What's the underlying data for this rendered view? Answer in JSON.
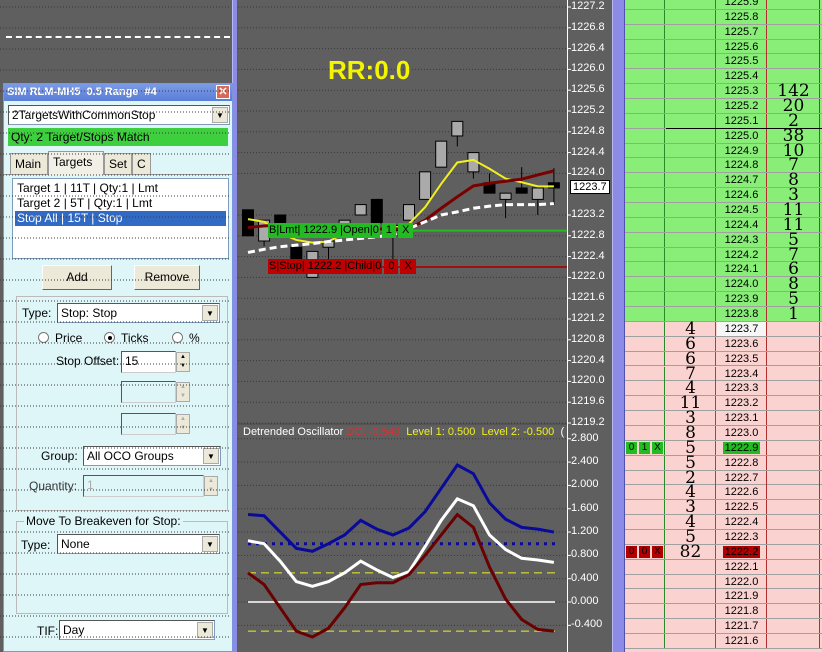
{
  "colors": {
    "chart_bg": "#5f5f5f",
    "ask_bg": "#88ee77",
    "bid_bg": "#fad2d0",
    "buy": "#22bb22",
    "sell": "#c00000",
    "ma_fast": "#f0f020",
    "ma_slow": "#7a0000",
    "ma_dash": "#ffffff"
  },
  "panel": {
    "title": "SIM RLM-MH5  0.5 Range  #4",
    "close_icon": "close-icon",
    "strategy": "2TargetsWithCommonStop",
    "status": "Qty: 2 Target/Stops Match",
    "tabs": [
      "Main",
      "Targets",
      "Set",
      "C"
    ],
    "active_tab": "Targets",
    "list_items": [
      "Target 1 | 11T | Qty:1 | Lmt",
      "Target 2 | 5T | Qty:1 | Lmt",
      "Stop All | 15T | Stop"
    ],
    "selected_item": 2,
    "add_label": "Add",
    "remove_label": "Remove",
    "type_label": "Type:",
    "type_value": "Stop: Stop",
    "radio_price": "Price",
    "radio_ticks": "Ticks",
    "radio_pct": "%",
    "radio_selected": "Ticks",
    "stop_offset_label": "Stop Offset:",
    "stop_offset_value": "15",
    "group_label": "Group:",
    "group_value": "All OCO Groups",
    "quantity_label": "Quantity:",
    "quantity_value": "1",
    "breakeven_title": "Move To Breakeven for Stop:",
    "breakeven_type_label": "Type:",
    "breakeven_type_value": "None",
    "tif_label": "TIF:",
    "tif_value": "Day"
  },
  "chart": {
    "rr_label": "RR:0.0",
    "current_price": "1223.7",
    "price_ticks": [
      "1227.2",
      "1226.8",
      "1226.4",
      "1226.0",
      "1225.6",
      "1225.2",
      "1224.8",
      "1224.4",
      "1224.0",
      "1223.2",
      "1222.8",
      "1222.4",
      "1222.0",
      "1221.6",
      "1221.2",
      "1220.8",
      "1220.4",
      "1220.0",
      "1219.6",
      "1219.2"
    ],
    "buy_order": {
      "label": "B|Lmt| 1222.9 |Open|0",
      "qty": "1",
      "close": "X",
      "price": 1222.9
    },
    "stop_order": {
      "label": "S|Stop| 1222.2 |Child|0",
      "qty": "0",
      "close": "X",
      "price": 1222.2
    }
  },
  "chart_data": [
    {
      "type": "candlestick",
      "title": "",
      "ylim": [
        1219.2,
        1227.2
      ],
      "candles": [
        [
          1223.3,
          1223.3,
          1222.8,
          1222.8
        ],
        [
          1222.7,
          1223.1,
          1222.6,
          1223.1
        ],
        [
          1223.2,
          1223.2,
          1222.87,
          1222.87
        ],
        [
          1222.58,
          1222.58,
          1222.33,
          1222.33
        ],
        [
          1222.0,
          1222.5,
          1222.0,
          1222.5
        ],
        [
          1222.58,
          1222.7,
          1222.28,
          1222.7
        ],
        [
          1222.95,
          1223.1,
          1222.95,
          1223.1
        ],
        [
          1223.2,
          1223.4,
          1223.2,
          1223.4
        ],
        [
          1223.5,
          1223.5,
          1223.05,
          1223.05
        ],
        [
          1222.9,
          1223.0,
          1222.25,
          1223.0
        ],
        [
          1223.1,
          1223.4,
          1223.1,
          1223.4
        ],
        [
          1223.5,
          1224.03,
          1223.5,
          1224.03
        ],
        [
          1224.12,
          1224.62,
          1224.12,
          1224.62
        ],
        [
          1224.72,
          1225.0,
          1224.52,
          1225.0
        ],
        [
          1224.03,
          1224.4,
          1223.9,
          1224.4
        ],
        [
          1223.82,
          1224.0,
          1223.62,
          1223.62
        ],
        [
          1223.5,
          1223.62,
          1223.14,
          1223.62
        ],
        [
          1223.72,
          1224.12,
          1223.62,
          1223.62
        ],
        [
          1223.5,
          1223.72,
          1223.2,
          1223.72
        ],
        [
          1223.82,
          1224.1,
          1223.4,
          1223.72
        ]
      ],
      "candle_format": [
        "open",
        "high",
        "low",
        "close"
      ],
      "series": [
        {
          "name": "fast-ma",
          "values": [
            1223.12,
            1223.07,
            1222.85,
            1222.72,
            1222.67,
            1222.69,
            1222.85,
            1222.94,
            1222.94,
            1222.94,
            1223.03,
            1223.35,
            1223.8,
            1224.21,
            1224.26,
            1224.09,
            1223.9,
            1223.83,
            1223.75,
            1223.75
          ]
        },
        {
          "name": "slow-ma",
          "values": [
            1222.96,
            1222.99,
            1223.0,
            1222.98,
            1222.96,
            1222.95,
            1222.94,
            1222.94,
            1222.93,
            1222.93,
            1222.94,
            1223.1,
            1223.33,
            1223.55,
            1223.76,
            1223.81,
            1223.85,
            1223.89,
            1223.97,
            1224.05
          ]
        },
        {
          "name": "dashed-ma",
          "values": [
            1222.48,
            1222.54,
            1222.59,
            1222.62,
            1222.65,
            1222.69,
            1222.72,
            1222.75,
            1222.78,
            1222.82,
            1222.94,
            1223.07,
            1223.2,
            1223.26,
            1223.33,
            1223.37,
            1223.4,
            1223.4,
            1223.4,
            1223.42
          ]
        }
      ]
    },
    {
      "type": "line",
      "title": "Detrended Oscillator",
      "legend": [
        "DO: -0.540",
        "Level 1: 0.500",
        "Level 2: -0.500",
        "("
      ],
      "ylim": [
        -0.6,
        3.0
      ],
      "yticks": [
        "2.800",
        "2.400",
        "2.000",
        "1.600",
        "1.200",
        "0.800",
        "0.400",
        "0.000",
        "-0.400"
      ],
      "series": [
        {
          "name": "upper-band",
          "values": [
            1.5,
            1.48,
            1.2,
            0.92,
            0.87,
            1.0,
            1.15,
            1.4,
            1.25,
            1.15,
            1.27,
            1.55,
            1.95,
            2.35,
            2.2,
            1.7,
            1.42,
            1.28,
            1.25,
            1.2
          ]
        },
        {
          "name": "mid-band",
          "values": [
            1.05,
            1.0,
            0.7,
            0.35,
            0.27,
            0.35,
            0.5,
            0.7,
            0.55,
            0.42,
            0.52,
            0.95,
            1.4,
            1.77,
            1.65,
            1.15,
            0.9,
            0.75,
            0.72,
            0.68
          ]
        },
        {
          "name": "do",
          "values": [
            0.5,
            0.3,
            -0.1,
            -0.5,
            -0.6,
            -0.45,
            -0.1,
            0.3,
            0.33,
            0.33,
            0.47,
            0.8,
            1.15,
            1.5,
            1.28,
            0.6,
            0.05,
            -0.3,
            -0.47,
            -0.5
          ]
        }
      ],
      "levels": {
        "dotted_blue": 1.0,
        "level1": 0.5,
        "level2": -0.5,
        "zero": 0.0
      }
    }
  ],
  "ladder": {
    "rows": [
      {
        "p": "1225.9"
      },
      {
        "p": "1225.8"
      },
      {
        "p": "1225.7"
      },
      {
        "p": "1225.6"
      },
      {
        "p": "1225.5"
      },
      {
        "p": "1225.4"
      },
      {
        "p": "1225.3",
        "ask": "142"
      },
      {
        "p": "1225.2",
        "ask": "20"
      },
      {
        "p": "1225.1",
        "ask": "2"
      },
      {
        "p": "1225.0",
        "ask": "38"
      },
      {
        "p": "1224.9",
        "ask": "10"
      },
      {
        "p": "1224.8",
        "ask": "7"
      },
      {
        "p": "1224.7",
        "ask": "8"
      },
      {
        "p": "1224.6",
        "ask": "3"
      },
      {
        "p": "1224.5",
        "ask": "11"
      },
      {
        "p": "1224.4",
        "ask": "11"
      },
      {
        "p": "1224.3",
        "ask": "5"
      },
      {
        "p": "1224.2",
        "ask": "7"
      },
      {
        "p": "1224.1",
        "ask": "6"
      },
      {
        "p": "1224.0",
        "ask": "8"
      },
      {
        "p": "1223.9",
        "ask": "5"
      },
      {
        "p": "1223.8",
        "ask": "1"
      },
      {
        "p": "1223.7",
        "bid": "4",
        "last": true
      },
      {
        "p": "1223.6",
        "bid": "6"
      },
      {
        "p": "1223.5",
        "bid": "6"
      },
      {
        "p": "1223.4",
        "bid": "7"
      },
      {
        "p": "1223.3",
        "bid": "4"
      },
      {
        "p": "1223.2",
        "bid": "11"
      },
      {
        "p": "1223.1",
        "bid": "3"
      },
      {
        "p": "1223.0",
        "bid": "8"
      },
      {
        "p": "1222.9",
        "bid": "5",
        "order": "buy",
        "o": [
          "0",
          "1",
          "X"
        ]
      },
      {
        "p": "1222.8",
        "bid": "5"
      },
      {
        "p": "1222.7",
        "bid": "2"
      },
      {
        "p": "1222.6",
        "bid": "4"
      },
      {
        "p": "1222.5",
        "bid": "3"
      },
      {
        "p": "1222.4",
        "bid": "4"
      },
      {
        "p": "1222.3",
        "bid": "5"
      },
      {
        "p": "1222.2",
        "bid": "82",
        "order": "sell",
        "o": [
          "0",
          "0",
          "X"
        ]
      },
      {
        "p": "1222.1"
      },
      {
        "p": "1222.0"
      },
      {
        "p": "1221.9"
      },
      {
        "p": "1221.8"
      },
      {
        "p": "1221.7"
      },
      {
        "p": "1221.6"
      }
    ]
  }
}
